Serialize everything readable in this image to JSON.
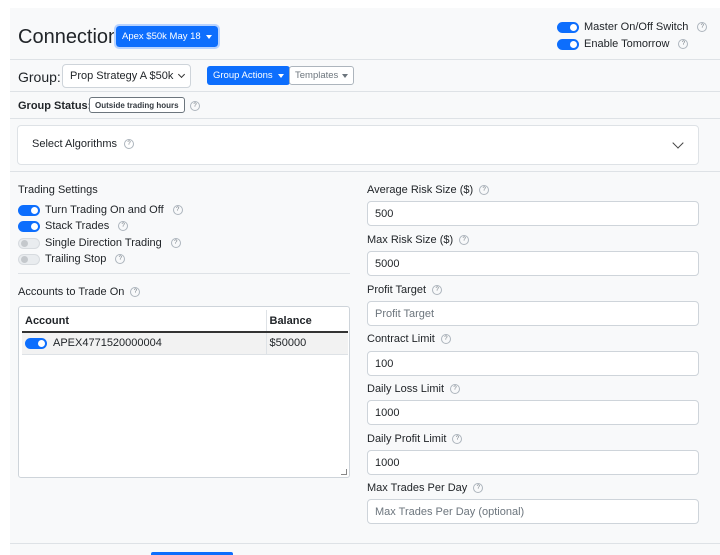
{
  "icons": {
    "help_glyph": "?",
    "help_icon": "question-circle-icon",
    "dropdown_icon": "caret-down-icon"
  },
  "colors": {
    "primary": "#0d6efd",
    "panel_background": "#f8f9fa",
    "border": "#ced4da",
    "placeholder": "#6c757d"
  },
  "header": {
    "connection_label": "Connection:",
    "connection_value": "Apex $50k May 18",
    "master_switch": "Master On/Off Switch",
    "master_switch_on": true,
    "enable_tomorrow": "Enable Tomorrow",
    "enable_tomorrow_on": true
  },
  "group": {
    "label": "Group:",
    "value": "Prop Strategy A $50k",
    "actions_label": "Group Actions",
    "templates_label": "Templates",
    "status_label": "Group Status:",
    "status_value": "Outside trading hours"
  },
  "algorithms": {
    "label": "Select Algorithms",
    "expanded": false
  },
  "trading_settings": {
    "title": "Trading Settings",
    "items": [
      {
        "label": "Turn Trading On and Off",
        "on": true
      },
      {
        "label": "Stack Trades",
        "on": true
      },
      {
        "label": "Single Direction Trading",
        "on": false
      },
      {
        "label": "Trailing Stop",
        "on": false
      }
    ]
  },
  "accounts": {
    "title": "Accounts to Trade On",
    "columns": [
      "Account",
      "Balance"
    ],
    "rows": [
      {
        "account": "APEX4771520000004",
        "balance": "$50000",
        "enabled": true
      }
    ]
  },
  "fields": [
    {
      "label": "Average Risk Size ($)",
      "value": "500"
    },
    {
      "label": "Max Risk Size ($)",
      "value": "5000"
    },
    {
      "label": "Profit Target",
      "value": "",
      "placeholder": "Profit Target"
    },
    {
      "label": "Contract Limit",
      "value": "100"
    },
    {
      "label": "Daily Loss Limit",
      "value": "1000"
    },
    {
      "label": "Daily Profit Limit",
      "value": "1000"
    },
    {
      "label": "Max Trades Per Day",
      "value": "",
      "placeholder": "Max Trades Per Day (optional)"
    }
  ]
}
